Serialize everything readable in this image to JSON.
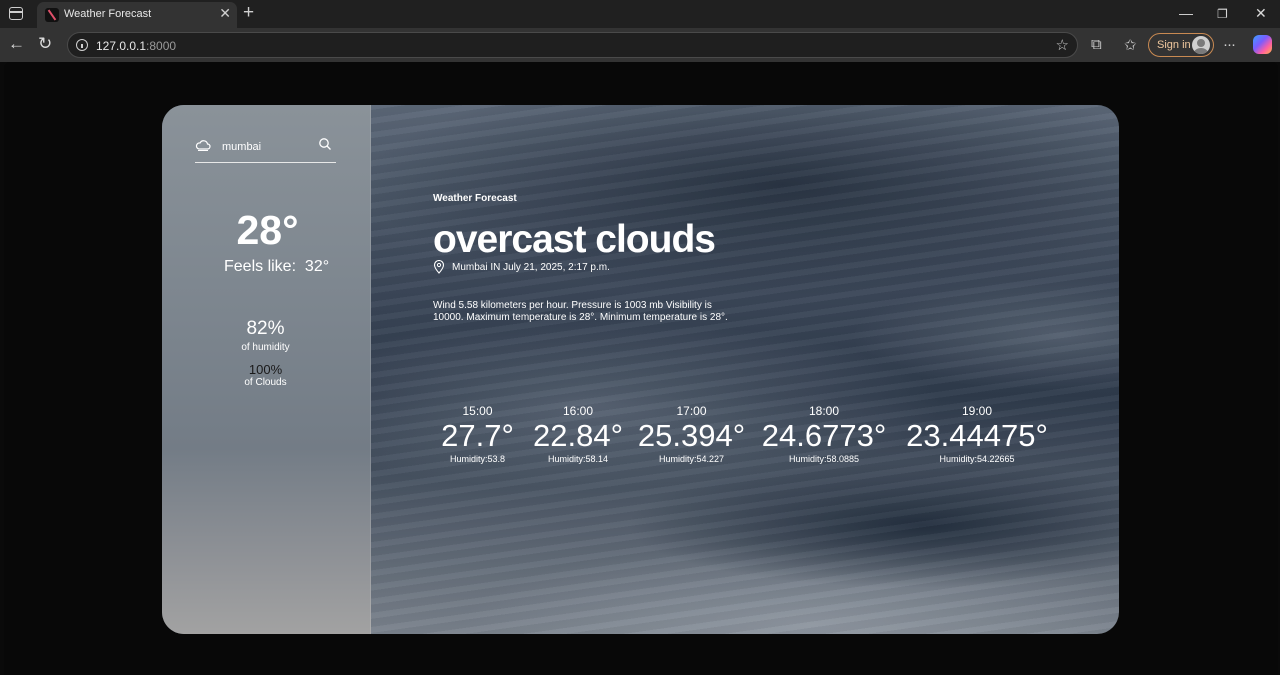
{
  "browser": {
    "tab_title": "Weather Forecast",
    "url_host": "127.0.0.1",
    "url_port": ":8000",
    "signin_label": "Sign in"
  },
  "sidebar": {
    "search_value": "mumbai",
    "current_temp": "28°",
    "feels_like_label": "Feels like:",
    "feels_like_value": "32°",
    "humidity_value": "82%",
    "humidity_label": "of humidity",
    "clouds_value": "100%",
    "clouds_label": "of Clouds"
  },
  "main": {
    "app_label": "Weather Forecast",
    "condition": "overcast clouds",
    "location": "Mumbai IN July 21, 2025, 2:17 p.m.",
    "description": "Wind 5.58 kilometers per hour. Pressure is 1003 mb Visibility is 10000. Maximum temperature is 28°. Minimum temperature is 28°."
  },
  "forecast": [
    {
      "time": "15:00",
      "temp": "27.7°",
      "humidity": "Humidity:53.8"
    },
    {
      "time": "16:00",
      "temp": "22.84°",
      "humidity": "Humidity:58.14"
    },
    {
      "time": "17:00",
      "temp": "25.394°",
      "humidity": "Humidity:54.227"
    },
    {
      "time": "18:00",
      "temp": "24.6773°",
      "humidity": "Humidity:58.0885"
    },
    {
      "time": "19:00",
      "temp": "23.44475°",
      "humidity": "Humidity:54.22665"
    }
  ],
  "colors": {
    "accent_signin": "#c98a52",
    "page_background": "#080808"
  }
}
